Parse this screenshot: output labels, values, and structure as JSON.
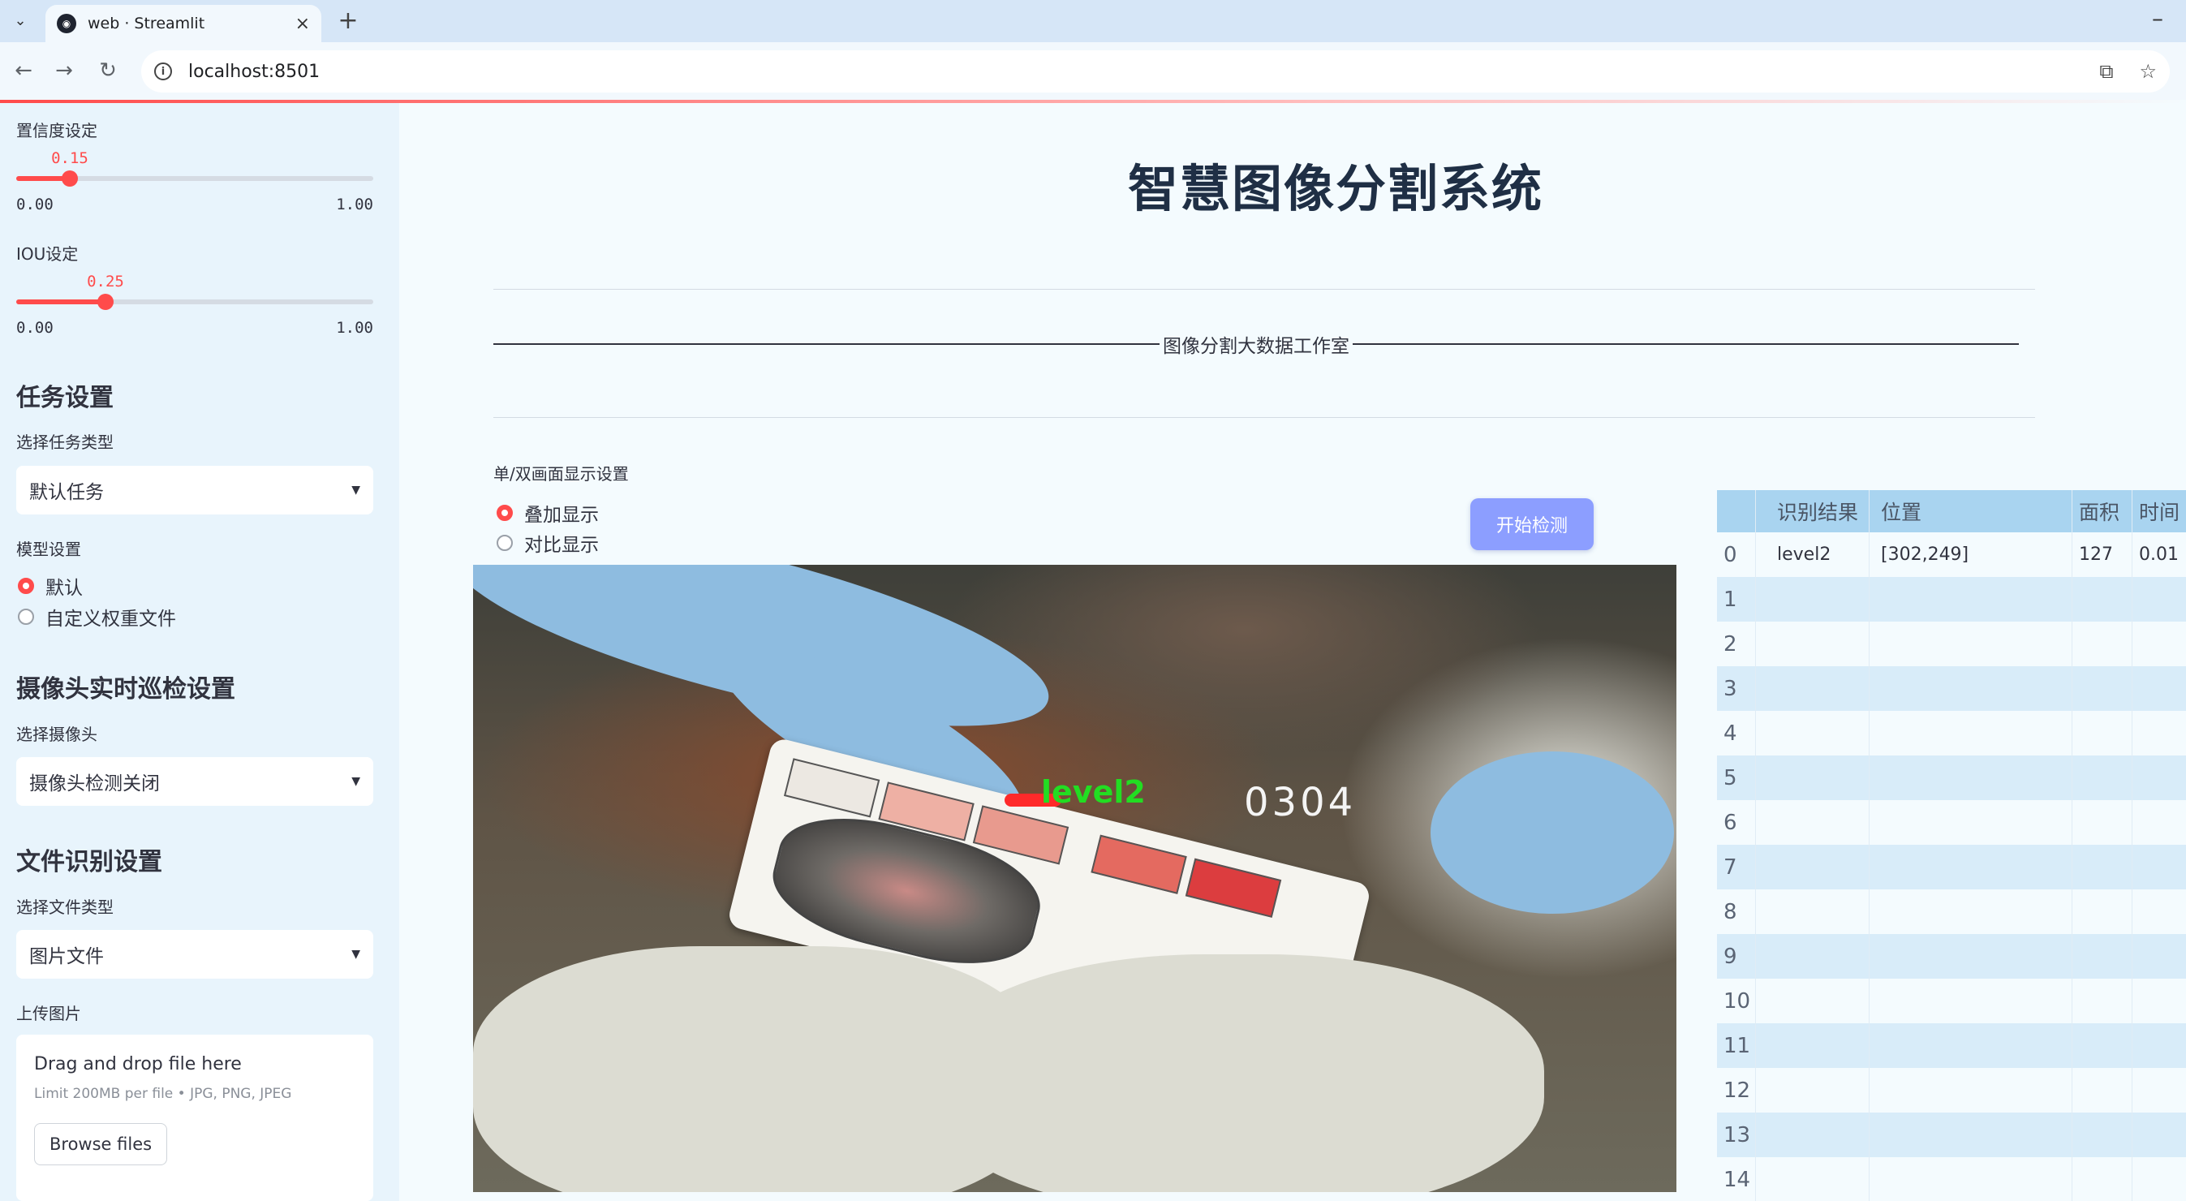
{
  "browser": {
    "tab_title": "web · Streamlit",
    "url": "localhost:8501"
  },
  "sidebar": {
    "confidence": {
      "label": "置信度设定",
      "value": "0.15",
      "value_num": 0.15,
      "min": "0.00",
      "max": "1.00"
    },
    "iou": {
      "label": "IOU设定",
      "value": "0.25",
      "value_num": 0.25,
      "min": "0.00",
      "max": "1.00"
    },
    "task_heading": "任务设置",
    "task_type_label": "选择任务类型",
    "task_type_value": "默认任务",
    "model_label": "模型设置",
    "model_options": [
      "默认",
      "自定义权重文件"
    ],
    "model_selected": "默认",
    "camera_heading": "摄像头实时巡检设置",
    "camera_label": "选择摄像头",
    "camera_value": "摄像头检测关闭",
    "file_heading": "文件识别设置",
    "file_type_label": "选择文件类型",
    "file_type_value": "图片文件",
    "upload_label": "上传图片",
    "upload_title": "Drag and drop file here",
    "upload_limit": "Limit 200MB per file • JPG, PNG, JPEG",
    "browse_label": "Browse files"
  },
  "main": {
    "title": "智慧图像分割系统",
    "subtitle": "图像分割大数据工作室",
    "display_label": "单/双画面显示设置",
    "display_options": [
      "叠加显示",
      "对比显示"
    ],
    "display_selected": "叠加显示",
    "start_button": "开始检测",
    "image": {
      "detection_label": "level2",
      "card_text": "0304"
    }
  },
  "table": {
    "headers": [
      "",
      "识别结果",
      "位置",
      "面积",
      "时间"
    ],
    "rows": [
      [
        "0",
        "level2",
        "[302,249]",
        "127",
        "0.01"
      ],
      [
        "1",
        "",
        "",
        "",
        ""
      ],
      [
        "2",
        "",
        "",
        "",
        ""
      ],
      [
        "3",
        "",
        "",
        "",
        ""
      ],
      [
        "4",
        "",
        "",
        "",
        ""
      ],
      [
        "5",
        "",
        "",
        "",
        ""
      ],
      [
        "6",
        "",
        "",
        "",
        ""
      ],
      [
        "7",
        "",
        "",
        "",
        ""
      ],
      [
        "8",
        "",
        "",
        "",
        ""
      ],
      [
        "9",
        "",
        "",
        "",
        ""
      ],
      [
        "10",
        "",
        "",
        "",
        ""
      ],
      [
        "11",
        "",
        "",
        "",
        ""
      ],
      [
        "12",
        "",
        "",
        "",
        ""
      ],
      [
        "13",
        "",
        "",
        "",
        ""
      ],
      [
        "14",
        "",
        "",
        "",
        ""
      ]
    ]
  },
  "colors": {
    "accent": "#ff4b4b",
    "button": "#8c9eff",
    "sidebar_bg": "#e8f4fc",
    "table_head": "#a9d4f0",
    "detection_text": "#22dd22"
  }
}
